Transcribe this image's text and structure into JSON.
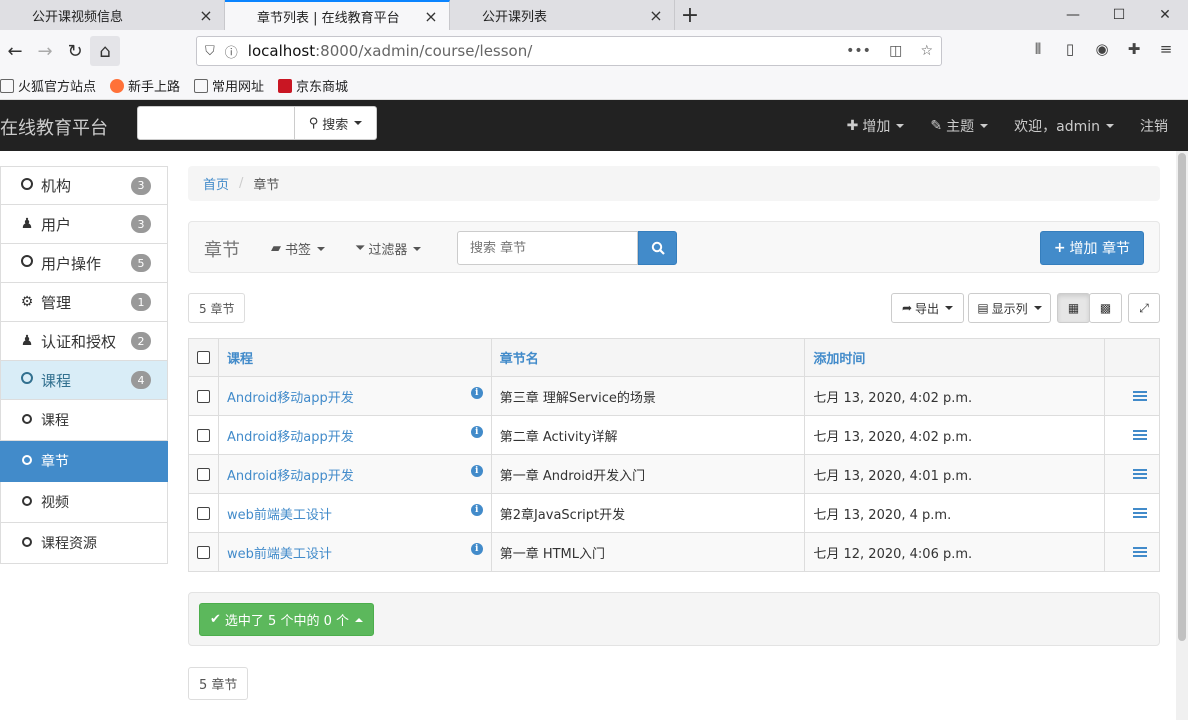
{
  "browser": {
    "tabs": [
      {
        "title": "公开课视频信息",
        "active": false
      },
      {
        "title": "章节列表 | 在线教育平台",
        "active": true
      },
      {
        "title": "公开课列表",
        "active": false
      }
    ],
    "url_host": "localhost",
    "url_path": ":8000/xadmin/course/lesson/",
    "bookmarks": [
      "火狐官方站点",
      "新手上路",
      "常用网址",
      "京东商城"
    ]
  },
  "header": {
    "brand": "在线教育平台",
    "search_button": "搜索",
    "nav": {
      "add": "增加",
      "theme": "主题",
      "welcome": "欢迎，admin",
      "logout": "注销"
    }
  },
  "sidebar": {
    "items": [
      {
        "label": "机构",
        "badge": "3",
        "icon": "circle-icon"
      },
      {
        "label": "用户",
        "badge": "3",
        "icon": "user-icon"
      },
      {
        "label": "用户操作",
        "badge": "5",
        "icon": "circle-icon"
      },
      {
        "label": "管理",
        "badge": "1",
        "icon": "gear-icon"
      },
      {
        "label": "认证和授权",
        "badge": "2",
        "icon": "users-icon"
      },
      {
        "label": "课程",
        "badge": "4",
        "icon": "circle-icon"
      }
    ],
    "subitems": [
      {
        "label": "课程"
      },
      {
        "label": "章节"
      },
      {
        "label": "视频"
      },
      {
        "label": "课程资源"
      }
    ]
  },
  "breadcrumb": {
    "home": "首页",
    "current": "章节"
  },
  "toolbar": {
    "title": "章节",
    "bookmarks": "书签",
    "filters": "过滤器",
    "search_placeholder": "搜索 章节",
    "add_button": "增加 章节"
  },
  "list": {
    "count_top": "5 章节",
    "export": "导出",
    "columns_btn": "显示列",
    "headers": [
      "课程",
      "章节名",
      "添加时间"
    ],
    "rows": [
      {
        "course": "Android移动app开发",
        "name": "第三章 理解Service的场景",
        "time": "七月 13, 2020, 4:02 p.m."
      },
      {
        "course": "Android移动app开发",
        "name": "第二章 Activity详解",
        "time": "七月 13, 2020, 4:02 p.m."
      },
      {
        "course": "Android移动app开发",
        "name": "第一章 Android开发入门",
        "time": "七月 13, 2020, 4:01 p.m."
      },
      {
        "course": "web前端美工设计",
        "name": "第2章JavaScript开发",
        "time": "七月 13, 2020, 4 p.m."
      },
      {
        "course": "web前端美工设计",
        "name": "第一章 HTML入门",
        "time": "七月 12, 2020, 4:06 p.m."
      }
    ],
    "selected_action": "选中了 5 个中的 0 个",
    "count_bottom": "5 章节"
  },
  "colors": {
    "primary": "#428bca",
    "success": "#5cb85c",
    "header_bg": "#222222",
    "sidebar_active": "#d9edf7"
  }
}
